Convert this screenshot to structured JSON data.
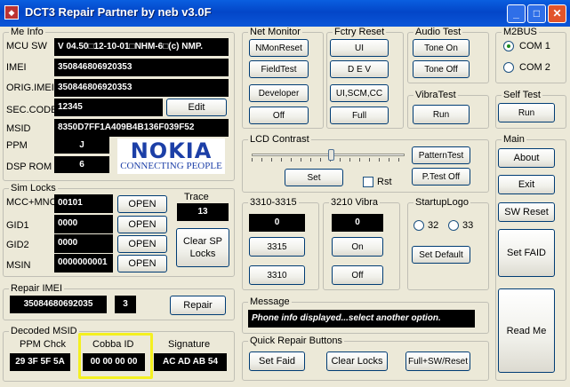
{
  "window": {
    "title": "DCT3 Repair Partner by neb v3.0F",
    "controls": {
      "minimize": "_",
      "maximize": "□",
      "close": "✕"
    }
  },
  "me_info": {
    "legend": "Me Info",
    "mcu_sw_label": "MCU SW",
    "mcu_sw": "V 04.50□12-10-01□NHM-6□(c) NMP.",
    "imei_label": "IMEI",
    "imei": "350846806920353",
    "orig_imei_label": "ORIG.IMEI",
    "orig_imei": "350846806920353",
    "sec_code_label": "SEC.CODE",
    "sec_code": "12345",
    "edit_label": "Edit",
    "msid_label": "MSID",
    "msid": "8350D7FF1A409B4B136F039F52",
    "ppm_label": "PPM",
    "ppm": "J",
    "dsp_rom_label": "DSP ROM",
    "dsp_rom": "6",
    "logo_text": "NOKIA",
    "logo_tagline": "CONNECTING PEOPLE"
  },
  "sim_locks": {
    "legend": "Sim Locks",
    "rows": [
      {
        "label": "MCC+MNC",
        "value": "00101",
        "button": "OPEN"
      },
      {
        "label": "GID1",
        "value": "0000",
        "button": "OPEN"
      },
      {
        "label": "GID2",
        "value": "0000",
        "button": "OPEN"
      },
      {
        "label": "MSIN",
        "value": "0000000001",
        "button": "OPEN"
      }
    ],
    "trace_label": "Trace",
    "trace_value": "13",
    "clear_sp_label_1": "Clear SP",
    "clear_sp_label_2": "Locks"
  },
  "repair_imei": {
    "legend": "Repair IMEI",
    "imei": "35084680692035",
    "check_digit": "3",
    "repair_label": "Repair"
  },
  "decoded_msid": {
    "legend": "Decoded MSID",
    "ppm_chck_label": "PPM Chck",
    "ppm_chck": "29 3F 5F 5A",
    "cobba_label": "Cobba ID",
    "cobba_id": "00 00 00 00",
    "signature_label": "Signature",
    "signature": "AC AD AB 54"
  },
  "net_monitor": {
    "legend": "Net Monitor",
    "buttons": [
      "NMonReset",
      "FieldTest",
      "Developer",
      "Off"
    ]
  },
  "fctry_reset": {
    "legend": "Fctry Reset",
    "buttons": [
      "UI",
      "D E V",
      "UI,SCM,CC",
      "Full"
    ]
  },
  "audio_test": {
    "legend": "Audio Test",
    "buttons": [
      "Tone On",
      "Tone Off"
    ]
  },
  "vibra_test": {
    "legend": "VibraTest",
    "button": "Run"
  },
  "m2bus": {
    "legend": "M2BUS",
    "com1": "COM 1",
    "com2": "COM 2",
    "selected": "COM 1"
  },
  "self_test": {
    "legend": "Self Test",
    "button": "Run"
  },
  "lcd_contrast": {
    "legend": "LCD Contrast",
    "set_label": "Set",
    "rst_label": "Rst",
    "rst_checked": false,
    "pattern_test_label": "PatternTest",
    "ptest_off_label": "P.Test Off"
  },
  "box_3310": {
    "legend": "3310-3315",
    "value": "0",
    "btn1": "3315",
    "btn2": "3310"
  },
  "vibra_3210": {
    "legend": "3210 Vibra",
    "value": "0",
    "btn1": "On",
    "btn2": "Off"
  },
  "startup_logo": {
    "legend": "StartupLogo",
    "opt1": "32",
    "opt2": "33",
    "set_default_label": "Set Default"
  },
  "main": {
    "legend": "Main",
    "about_label": "About",
    "exit_label": "Exit",
    "sw_reset_label": "SW Reset",
    "set_faid_label": "Set  FAID",
    "read_me_label": "Read Me"
  },
  "message": {
    "legend": "Message",
    "text": "Phone info displayed...select another option."
  },
  "quick_repair": {
    "legend": "Quick Repair Buttons",
    "set_faid_label": "Set Faid",
    "clear_locks_label": "Clear Locks",
    "full_sw_reset_label": "Full+SW/Reset"
  },
  "colors": {
    "titlebar": "#0346c8",
    "face": "#ece9d8",
    "lcd_background": "#000000",
    "highlight": "#f4f020",
    "nokia_blue": "#1c3fa7"
  }
}
